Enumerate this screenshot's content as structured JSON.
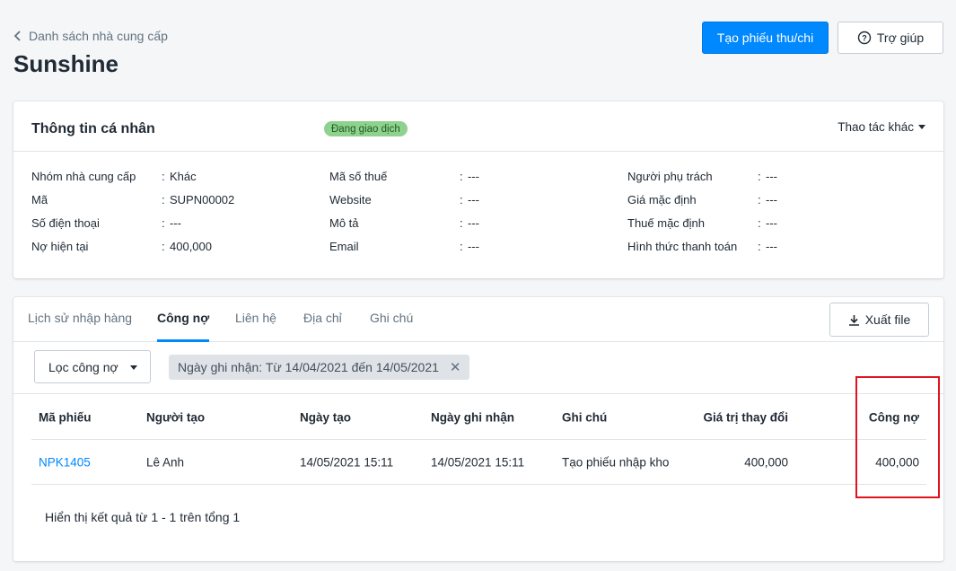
{
  "breadcrumb": "Danh sách nhà cung cấp",
  "page_title": "Sunshine",
  "header": {
    "primary_button": "Tạo phiếu thu/chi",
    "help_button": "Trợ giúp"
  },
  "info_card": {
    "title": "Thông tin cá nhân",
    "status": "Đang giao dịch",
    "more_actions": "Thao tác khác",
    "col1": [
      {
        "label": "Nhóm nhà cung cấp",
        "value": "Khác"
      },
      {
        "label": "Mã",
        "value": "SUPN00002"
      },
      {
        "label": "Số điện thoại",
        "value": "---"
      },
      {
        "label": "Nợ hiện tại",
        "value": "400,000"
      }
    ],
    "col2": [
      {
        "label": "Mã số thuế",
        "value": "---"
      },
      {
        "label": "Website",
        "value": "---"
      },
      {
        "label": "Mô tả",
        "value": "---"
      },
      {
        "label": "Email",
        "value": "---"
      }
    ],
    "col3": [
      {
        "label": "Người phụ trách",
        "value": "---"
      },
      {
        "label": "Giá mặc định",
        "value": "---"
      },
      {
        "label": "Thuế mặc định",
        "value": "---"
      },
      {
        "label": "Hình thức thanh toán",
        "value": "---"
      }
    ]
  },
  "tabs": [
    {
      "label": "Lịch sử nhập hàng"
    },
    {
      "label": "Công nợ"
    },
    {
      "label": "Liên hệ"
    },
    {
      "label": "Địa chỉ"
    },
    {
      "label": "Ghi chú"
    }
  ],
  "export_button": "Xuất file",
  "filter": {
    "select_label": "Lọc công nợ",
    "tag": "Ngày ghi nhận: Từ 14/04/2021 đến 14/05/2021"
  },
  "table": {
    "headers": [
      "Mã phiếu",
      "Người tạo",
      "Ngày tạo",
      "Ngày ghi nhận",
      "Ghi chú",
      "Giá trị thay đổi",
      "Công nợ"
    ],
    "rows": [
      [
        "NPK1405",
        "Lê Anh",
        "14/05/2021 15:11",
        "14/05/2021 15:11",
        "Tạo phiếu nhập kho",
        "400,000",
        "400,000"
      ]
    ]
  },
  "summary": "Hiển thị kết quả từ 1 - 1 trên tổng 1",
  "colors": {
    "accent": "#0088ff",
    "status_bg": "#8fd18f",
    "highlight": "#e0141e"
  }
}
